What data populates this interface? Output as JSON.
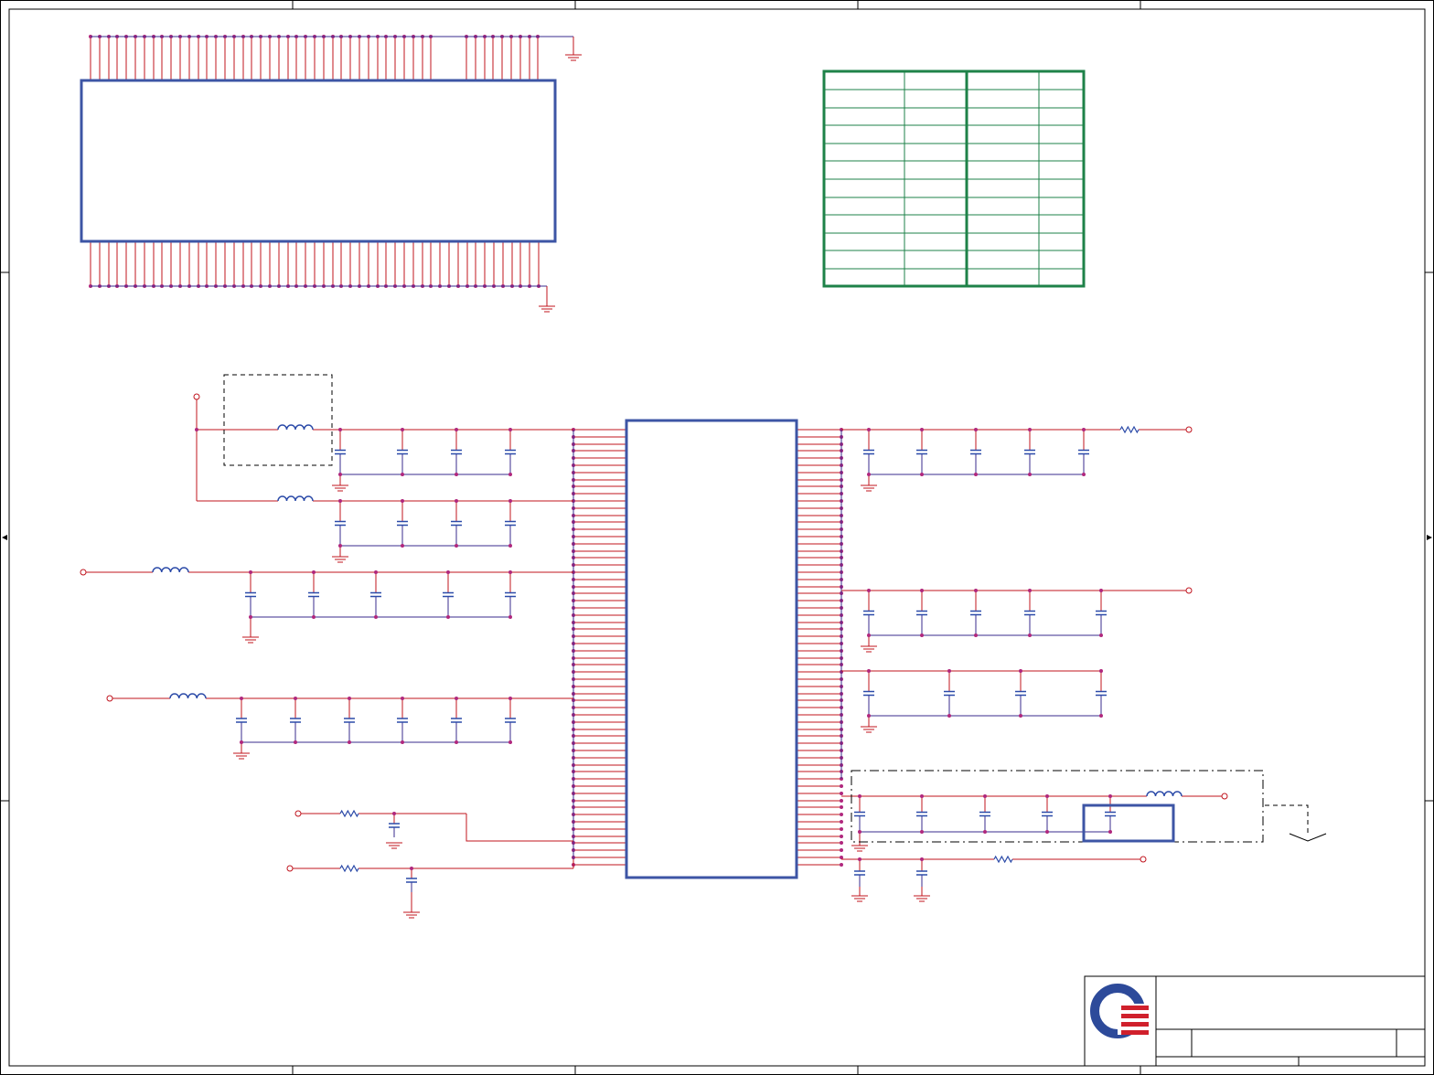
{
  "document": {
    "kind": "schematic-sheet",
    "text_content": [],
    "title_block": {
      "logo": "company-logo-icon",
      "title": "",
      "doc_number": "",
      "rev": ""
    }
  },
  "colors": {
    "sheet_border": "#000000",
    "wire_red": "#c0141e",
    "wire_purple": "#3a2b8c",
    "junction_magenta": "#b0277d",
    "component_blue": "#3d55a5",
    "table_green": "#1e8248",
    "cap_blue": "#2b4aa8",
    "logo_blue": "#2d4a9a",
    "logo_red": "#d0202c",
    "dashed": "#000000"
  },
  "symbols": {
    "chip_top": "connector-ic-symbol",
    "chip_main": "main-ic-symbol",
    "ground": "ground-icon",
    "capacitor": "capacitor-icon",
    "inductor": "inductor-icon",
    "resistor": "resistor-icon",
    "port": "net-port-icon"
  }
}
